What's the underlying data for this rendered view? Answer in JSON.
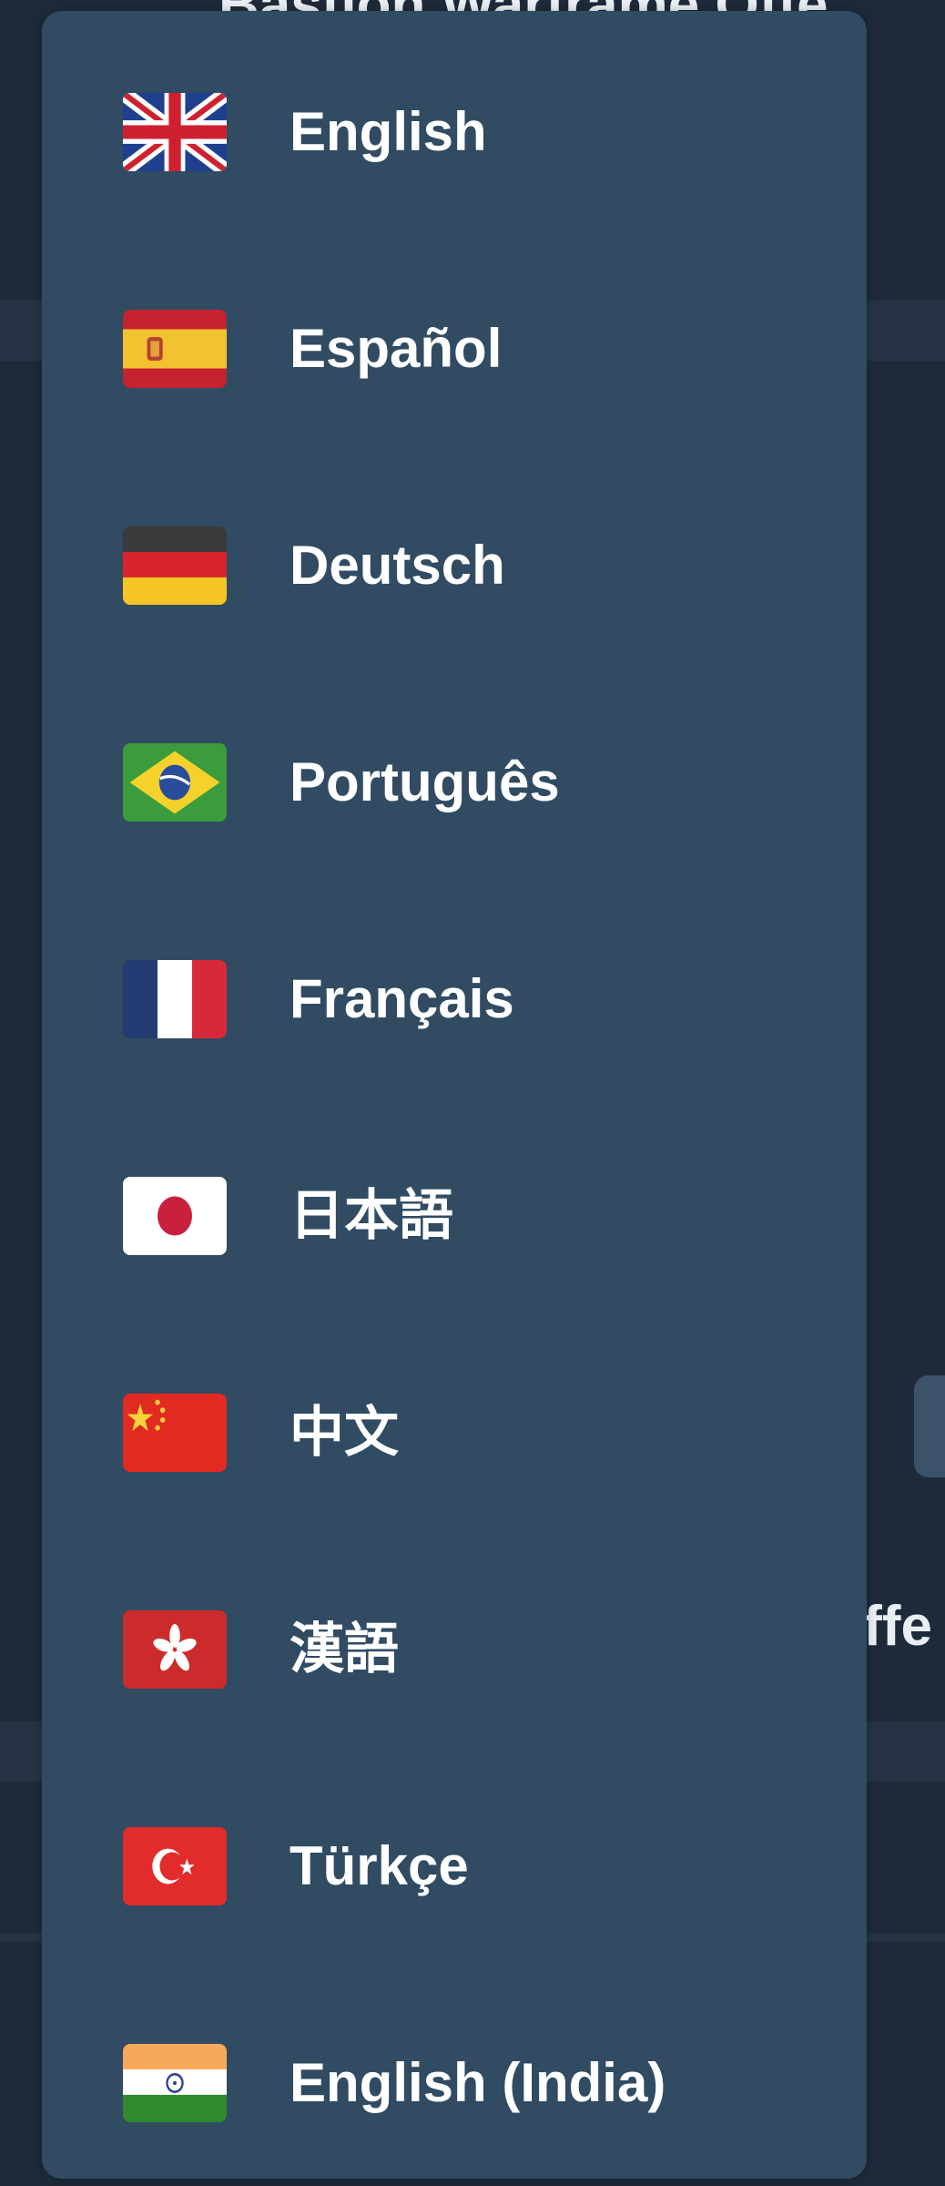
{
  "background": {
    "title": "Bastion Warframe Offe",
    "offer_fragment": "Offe"
  },
  "menu": {
    "items": [
      {
        "label": "English",
        "flag": "uk-flag-icon"
      },
      {
        "label": "Español",
        "flag": "spain-flag-icon"
      },
      {
        "label": "Deutsch",
        "flag": "germany-flag-icon"
      },
      {
        "label": "Português",
        "flag": "brazil-flag-icon"
      },
      {
        "label": "Français",
        "flag": "france-flag-icon"
      },
      {
        "label": "日本語",
        "flag": "japan-flag-icon"
      },
      {
        "label": "中文",
        "flag": "china-flag-icon"
      },
      {
        "label": "漢語",
        "flag": "hong-kong-flag-icon"
      },
      {
        "label": "Türkçe",
        "flag": "turkey-flag-icon"
      },
      {
        "label": "English (India)",
        "flag": "india-flag-icon"
      }
    ]
  },
  "colors": {
    "page_background": "#1e2a39",
    "menu_background": "#304b62",
    "text": "#ffffff"
  }
}
